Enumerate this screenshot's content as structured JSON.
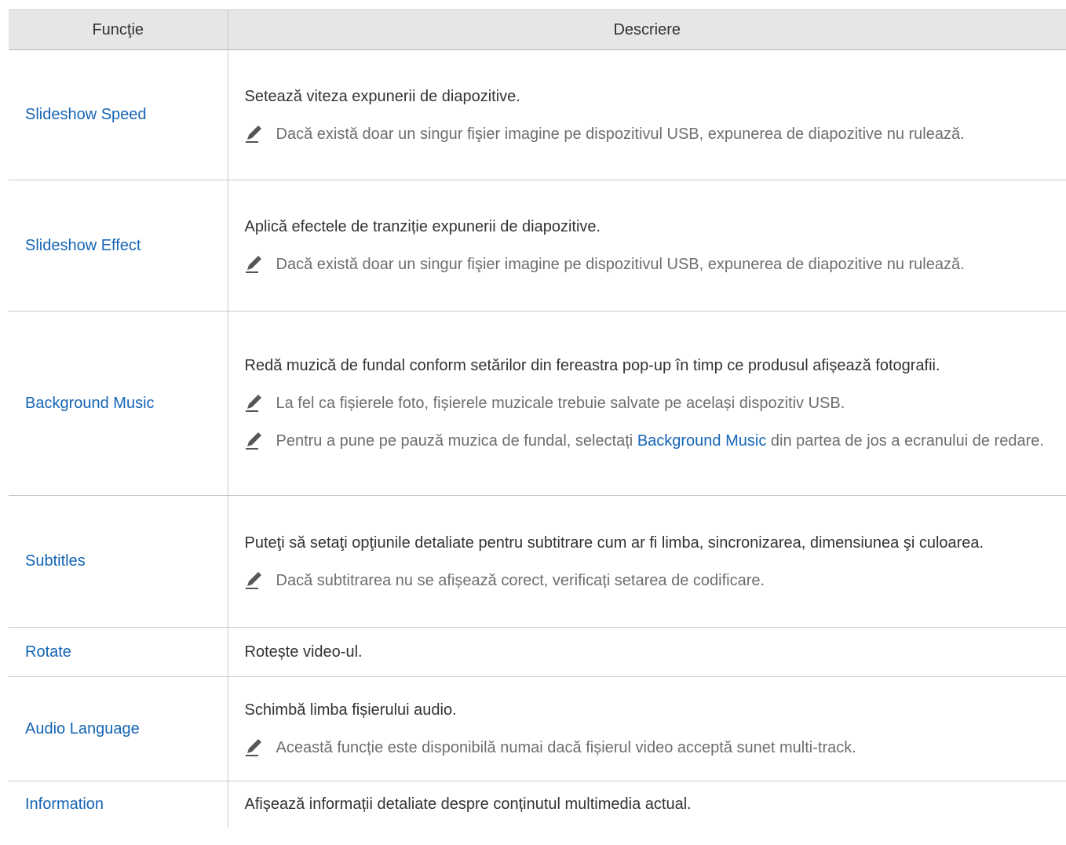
{
  "table": {
    "header": {
      "col_function": "Funcţie",
      "col_description": "Descriere"
    },
    "rows": [
      {
        "function": "Slideshow Speed",
        "description": "Setează viteza expunerii de diapozitive.",
        "notes": [
          "Dacă există doar un singur fişier imagine pe dispozitivul USB, expunerea de diapozitive nu rulează."
        ]
      },
      {
        "function": "Slideshow Effect",
        "description": "Aplică efectele de tranziție expunerii de diapozitive.",
        "notes": [
          "Dacă există doar un singur fişier imagine pe dispozitivul USB, expunerea de diapozitive nu rulează."
        ]
      },
      {
        "function": "Background Music",
        "description": "Redă muzică de fundal conform setărilor din fereastra pop-up în timp ce produsul afișează fotografii.",
        "notes": [
          "La fel ca fișierele foto, fișierele muzicale trebuie salvate pe același dispozitiv USB.",
          "Pentru a pune pe pauză muzica de fundal, selectați "
        ],
        "note2_highlight": "Background Music",
        "note2_suffix": " din partea de jos a ecranului de redare."
      },
      {
        "function": "Subtitles",
        "description": "Puteţi să setaţi opţiunile detaliate pentru subtitrare cum ar fi limba, sincronizarea, dimensiunea şi culoarea.",
        "notes": [
          "Dacă subtitrarea nu se afișează corect, verificați setarea de codificare."
        ]
      },
      {
        "function": "Rotate",
        "description": "Rotește video-ul.",
        "notes": []
      },
      {
        "function": "Audio Language",
        "description": "Schimbă limba fișierului audio.",
        "notes": [
          "Această funcție este disponibilă numai dacă fișierul video acceptă sunet multi-track."
        ]
      },
      {
        "function": "Information",
        "description": "Afișează informații detaliate despre conținutul multimedia actual.",
        "notes": []
      }
    ]
  },
  "icons": {
    "note_icon": "pencil-icon"
  },
  "colors": {
    "function_text": "#1565b5",
    "header_bg": "#e6e6e6",
    "note_text": "#6e6e6e"
  }
}
